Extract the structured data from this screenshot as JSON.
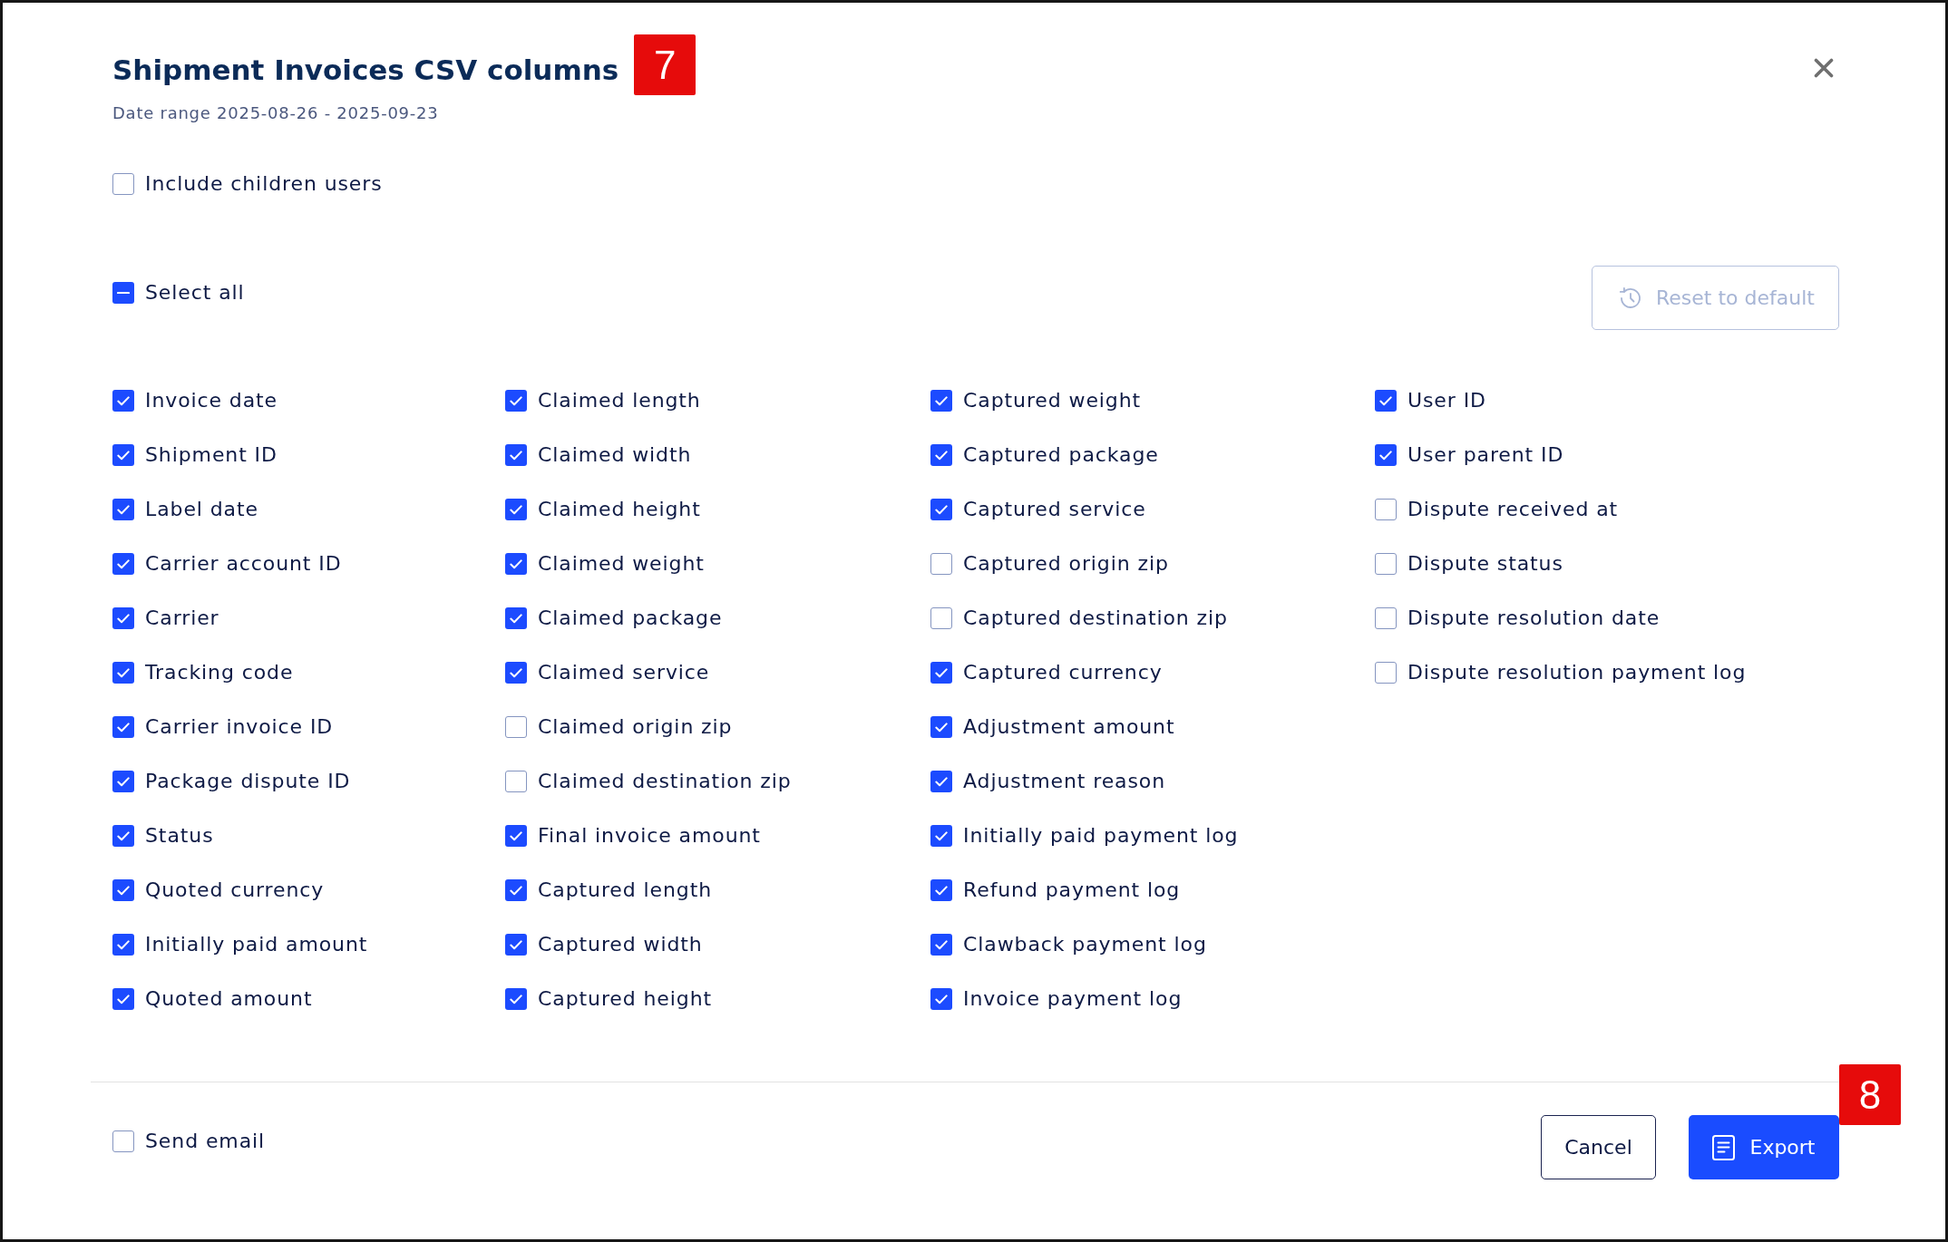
{
  "dialog": {
    "title": "Shipment Invoices CSV columns",
    "subtitle": "Date range 2025-08-26 - 2025-09-23"
  },
  "include_children_users": {
    "label": "Include children users",
    "checked": false
  },
  "select_all": {
    "label": "Select all",
    "checked": true,
    "indeterminate": true
  },
  "reset_button": {
    "label": "Reset to default",
    "disabled": true
  },
  "columns": [
    {
      "items": [
        {
          "label": "Invoice date",
          "checked": true
        },
        {
          "label": "Shipment ID",
          "checked": true
        },
        {
          "label": "Label date",
          "checked": true
        },
        {
          "label": "Carrier account ID",
          "checked": true
        },
        {
          "label": "Carrier",
          "checked": true
        },
        {
          "label": "Tracking code",
          "checked": true
        },
        {
          "label": "Carrier invoice ID",
          "checked": true
        },
        {
          "label": "Package dispute ID",
          "checked": true
        },
        {
          "label": "Status",
          "checked": true
        },
        {
          "label": "Quoted currency",
          "checked": true
        },
        {
          "label": "Initially paid amount",
          "checked": true
        },
        {
          "label": "Quoted amount",
          "checked": true
        }
      ]
    },
    {
      "items": [
        {
          "label": "Claimed length",
          "checked": true
        },
        {
          "label": "Claimed width",
          "checked": true
        },
        {
          "label": "Claimed height",
          "checked": true
        },
        {
          "label": "Claimed weight",
          "checked": true
        },
        {
          "label": "Claimed package",
          "checked": true
        },
        {
          "label": "Claimed service",
          "checked": true
        },
        {
          "label": "Claimed origin zip",
          "checked": false
        },
        {
          "label": "Claimed destination zip",
          "checked": false
        },
        {
          "label": "Final invoice amount",
          "checked": true
        },
        {
          "label": "Captured length",
          "checked": true
        },
        {
          "label": "Captured width",
          "checked": true
        },
        {
          "label": "Captured height",
          "checked": true
        }
      ]
    },
    {
      "items": [
        {
          "label": "Captured weight",
          "checked": true
        },
        {
          "label": "Captured package",
          "checked": true
        },
        {
          "label": "Captured service",
          "checked": true
        },
        {
          "label": "Captured origin zip",
          "checked": false
        },
        {
          "label": "Captured destination zip",
          "checked": false
        },
        {
          "label": "Captured currency",
          "checked": true
        },
        {
          "label": "Adjustment amount",
          "checked": true
        },
        {
          "label": "Adjustment reason",
          "checked": true
        },
        {
          "label": "Initially paid payment log",
          "checked": true
        },
        {
          "label": "Refund payment log",
          "checked": true
        },
        {
          "label": "Clawback payment log",
          "checked": true
        },
        {
          "label": "Invoice payment log",
          "checked": true
        }
      ]
    },
    {
      "items": [
        {
          "label": "User ID",
          "checked": true
        },
        {
          "label": "User parent ID",
          "checked": true
        },
        {
          "label": "Dispute received at",
          "checked": false
        },
        {
          "label": "Dispute status",
          "checked": false
        },
        {
          "label": "Dispute resolution date",
          "checked": false
        },
        {
          "label": "Dispute resolution payment log",
          "checked": false
        }
      ]
    }
  ],
  "send_email": {
    "label": "Send email",
    "checked": false
  },
  "buttons": [
    {
      "label": "Cancel",
      "kind": "secondary"
    },
    {
      "label": "Export",
      "kind": "primary"
    }
  ],
  "annotation_markers": [
    {
      "label": "7"
    },
    {
      "label": "8"
    }
  ]
}
